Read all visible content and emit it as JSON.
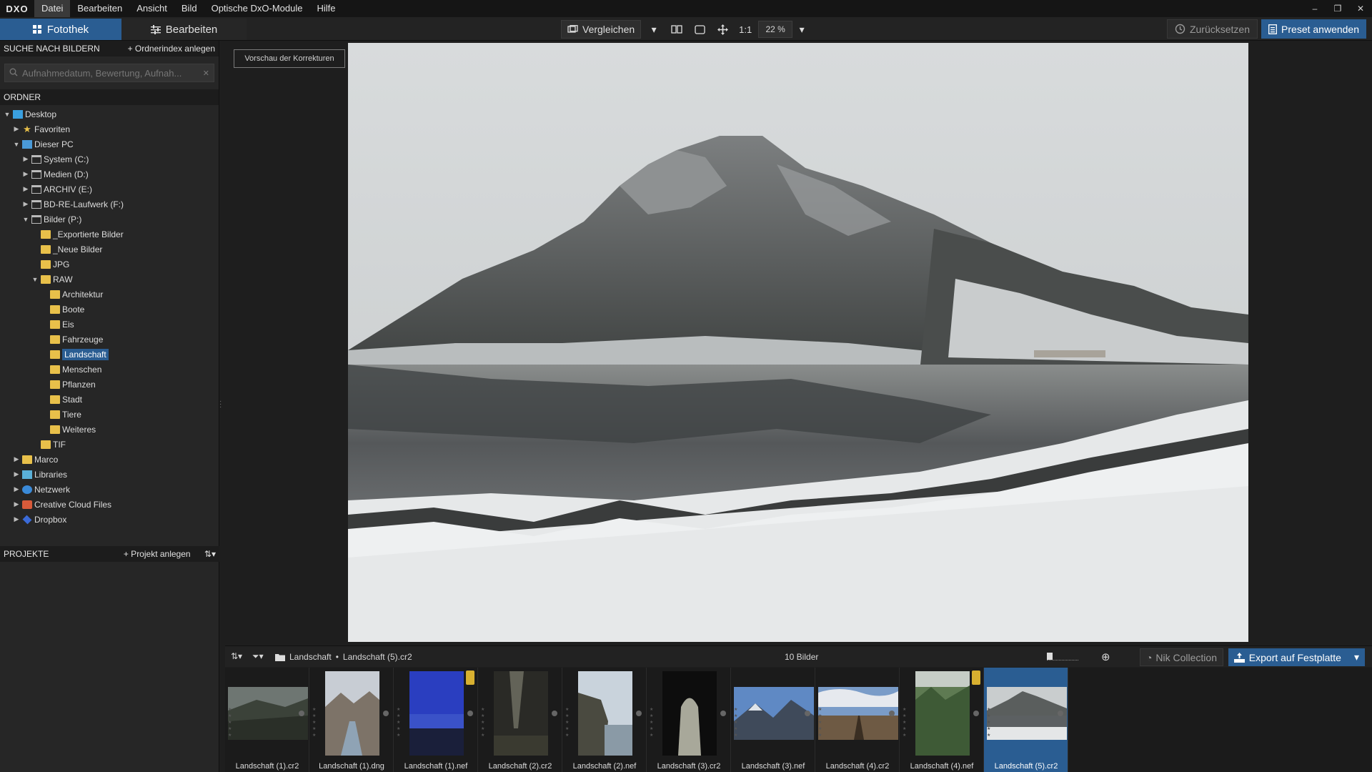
{
  "menu": {
    "logo": "DXO",
    "items": [
      "Datei",
      "Bearbeiten",
      "Ansicht",
      "Bild",
      "Optische DxO-Module",
      "Hilfe"
    ]
  },
  "window_controls": {
    "minimize": "–",
    "restore": "❐",
    "close": "✕"
  },
  "toolbar": {
    "tab_fotothek": "Fotothek",
    "tab_bearbeiten": "Bearbeiten",
    "compare": "Vergleichen",
    "one_to_one": "1:1",
    "zoom": "22 %",
    "reset": "Zurücksetzen",
    "preset": "Preset anwenden"
  },
  "search": {
    "header": "SUCHE NACH BILDERN",
    "action": "+ Ordnerindex anlegen",
    "placeholder": "Aufnahmedatum, Bewertung, Aufnah..."
  },
  "folders": {
    "header": "ORDNER",
    "items": [
      {
        "label": "Desktop",
        "depth": 0,
        "arrow": "▼",
        "icon": "desktop-icon"
      },
      {
        "label": "Favoriten",
        "depth": 1,
        "arrow": "▶",
        "icon": "star-icon"
      },
      {
        "label": "Dieser PC",
        "depth": 1,
        "arrow": "▼",
        "icon": "computer-icon"
      },
      {
        "label": "System (C:)",
        "depth": 2,
        "arrow": "▶",
        "icon": "drive-icon"
      },
      {
        "label": "Medien (D:)",
        "depth": 2,
        "arrow": "▶",
        "icon": "drive-icon"
      },
      {
        "label": "ARCHIV (E:)",
        "depth": 2,
        "arrow": "▶",
        "icon": "drive-icon"
      },
      {
        "label": "BD-RE-Laufwerk (F:)",
        "depth": 2,
        "arrow": "▶",
        "icon": "drive-icon"
      },
      {
        "label": "Bilder (P:)",
        "depth": 2,
        "arrow": "▼",
        "icon": "drive-icon"
      },
      {
        "label": "_Exportierte Bilder",
        "depth": 3,
        "arrow": "",
        "icon": "folder-icon"
      },
      {
        "label": "_Neue Bilder",
        "depth": 3,
        "arrow": "",
        "icon": "folder-icon"
      },
      {
        "label": "JPG",
        "depth": 3,
        "arrow": "",
        "icon": "folder-icon"
      },
      {
        "label": "RAW",
        "depth": 3,
        "arrow": "▼",
        "icon": "folder-icon"
      },
      {
        "label": "Architektur",
        "depth": 4,
        "arrow": "",
        "icon": "folder-icon"
      },
      {
        "label": "Boote",
        "depth": 4,
        "arrow": "",
        "icon": "folder-icon"
      },
      {
        "label": "Eis",
        "depth": 4,
        "arrow": "",
        "icon": "folder-icon"
      },
      {
        "label": "Fahrzeuge",
        "depth": 4,
        "arrow": "",
        "icon": "folder-icon"
      },
      {
        "label": "Landschaft",
        "depth": 4,
        "arrow": "",
        "icon": "folder-icon",
        "selected": true
      },
      {
        "label": "Menschen",
        "depth": 4,
        "arrow": "",
        "icon": "folder-icon"
      },
      {
        "label": "Pflanzen",
        "depth": 4,
        "arrow": "",
        "icon": "folder-icon"
      },
      {
        "label": "Stadt",
        "depth": 4,
        "arrow": "",
        "icon": "folder-icon"
      },
      {
        "label": "Tiere",
        "depth": 4,
        "arrow": "",
        "icon": "folder-icon"
      },
      {
        "label": "Weiteres",
        "depth": 4,
        "arrow": "",
        "icon": "folder-icon"
      },
      {
        "label": "TIF",
        "depth": 3,
        "arrow": "",
        "icon": "folder-icon"
      },
      {
        "label": "Marco",
        "depth": 1,
        "arrow": "▶",
        "icon": "folder-icon"
      },
      {
        "label": "Libraries",
        "depth": 1,
        "arrow": "▶",
        "icon": "library-icon"
      },
      {
        "label": "Netzwerk",
        "depth": 1,
        "arrow": "▶",
        "icon": "network-icon"
      },
      {
        "label": "Creative Cloud Files",
        "depth": 1,
        "arrow": "▶",
        "icon": "creative-cloud-icon"
      },
      {
        "label": "Dropbox",
        "depth": 1,
        "arrow": "▶",
        "icon": "dropbox-icon"
      }
    ]
  },
  "projects": {
    "header": "PROJEKTE",
    "action": "+ Projekt anlegen"
  },
  "viewer": {
    "preview_button": "Vorschau der Korrekturen"
  },
  "filmstrip_bar": {
    "folder": "Landschaft",
    "separator": "•",
    "file": "Landschaft (5).cr2",
    "count": "10 Bilder",
    "nik": "Nik Collection",
    "export": "Export auf Festplatte"
  },
  "thumbnails": [
    {
      "label": "Landschaft (1).cr2",
      "theme": "dark-valley"
    },
    {
      "label": "Landschaft (1).dng",
      "theme": "mountain-river"
    },
    {
      "label": "Landschaft (1).nef",
      "theme": "blue-night",
      "badge": true
    },
    {
      "label": "Landschaft (2).cr2",
      "theme": "forest-light"
    },
    {
      "label": "Landschaft (2).nef",
      "theme": "cliff-sea"
    },
    {
      "label": "Landschaft (3).cr2",
      "theme": "cave"
    },
    {
      "label": "Landschaft (3).nef",
      "theme": "blue-mountains"
    },
    {
      "label": "Landschaft (4).cr2",
      "theme": "rail-sky"
    },
    {
      "label": "Landschaft (4).nef",
      "theme": "green-valley",
      "badge": true
    },
    {
      "label": "Landschaft (5).cr2",
      "theme": "snow-lake",
      "selected": true
    }
  ],
  "colors": {
    "accent": "#2a5d92",
    "panel": "#262626",
    "background": "#1e1e1e"
  }
}
